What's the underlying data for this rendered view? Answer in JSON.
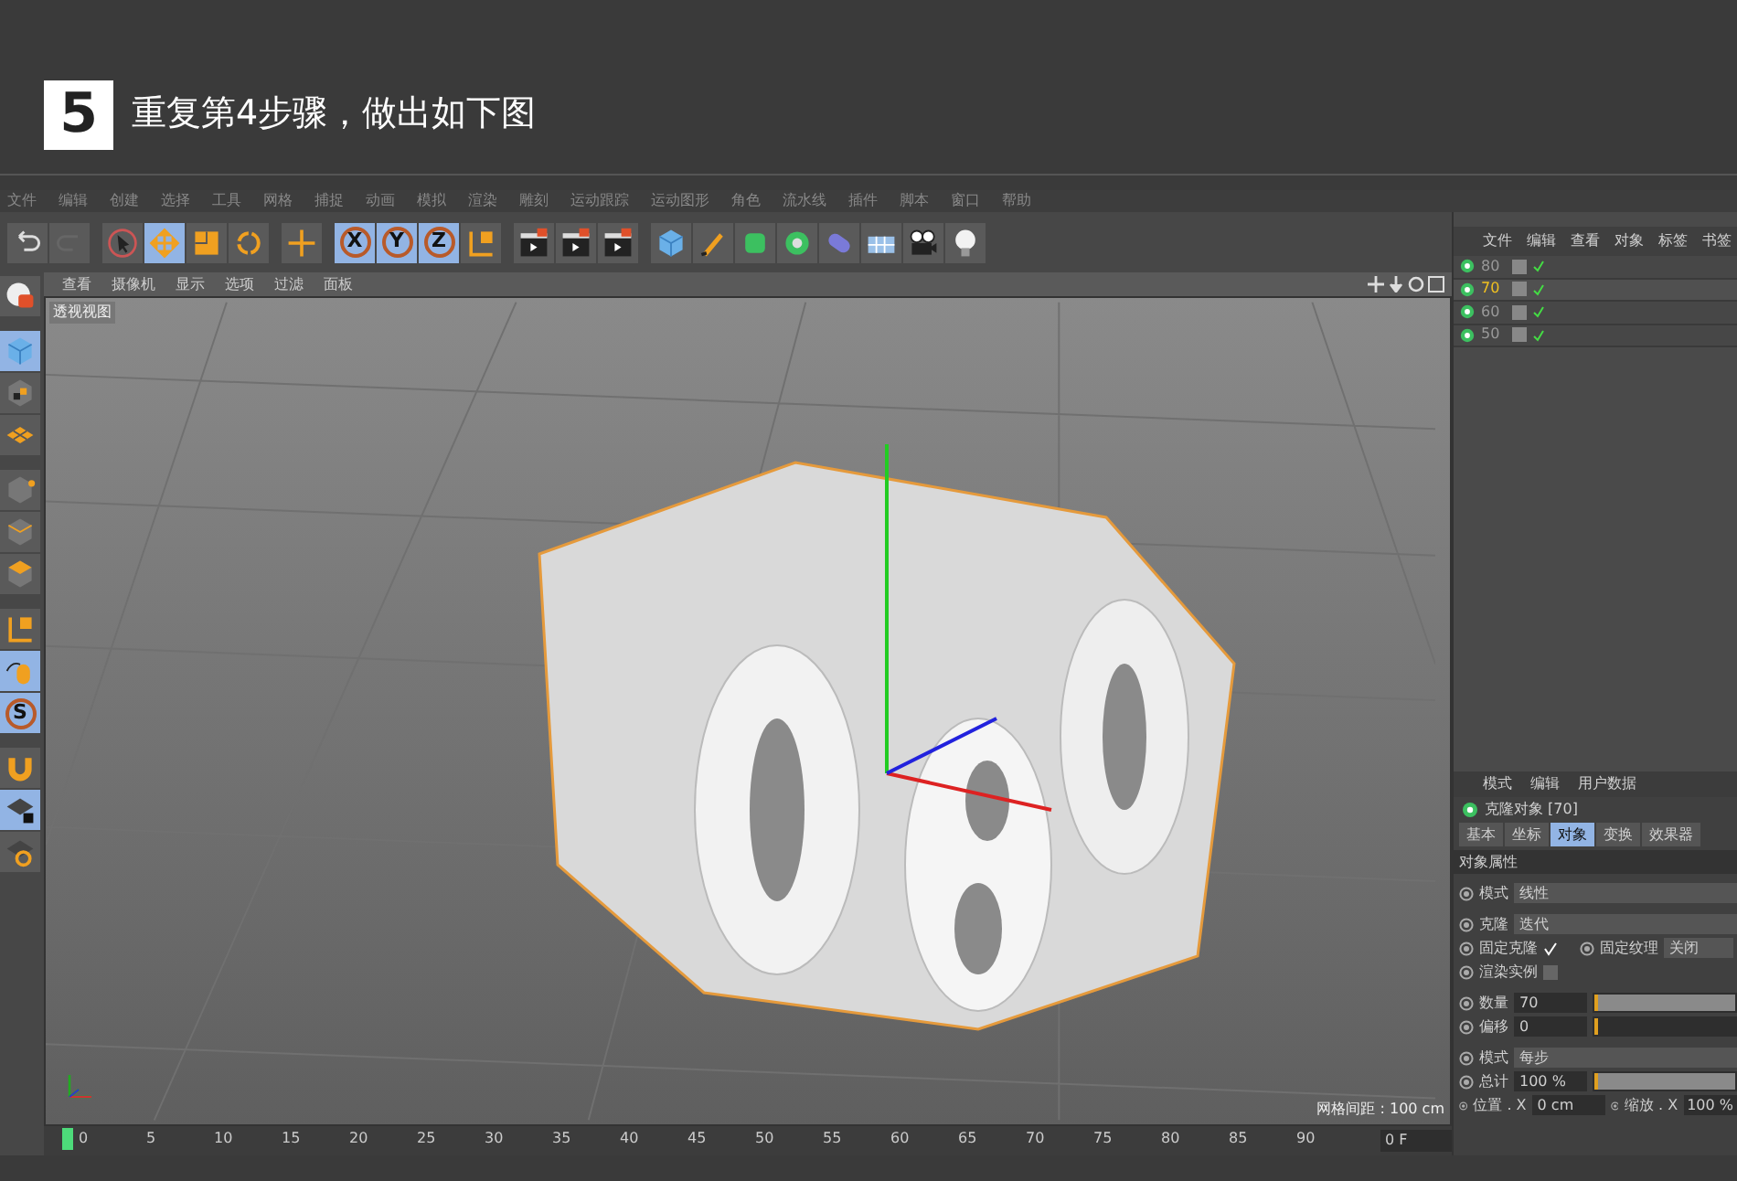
{
  "banner": {
    "step": "5",
    "title": "重复第4步骤，做出如下图"
  },
  "menu": [
    "文件",
    "编辑",
    "创建",
    "选择",
    "工具",
    "网格",
    "捕捉",
    "动画",
    "模拟",
    "渲染",
    "雕刻",
    "运动跟踪",
    "运动图形",
    "角色",
    "流水线",
    "插件",
    "脚本",
    "窗口",
    "帮助"
  ],
  "toolbar": [
    [
      {
        "kind": "undo",
        "selected": false
      },
      {
        "kind": "redo",
        "selected": false
      }
    ],
    [
      {
        "kind": "select",
        "selected": false
      },
      {
        "kind": "move",
        "selected": true
      },
      {
        "kind": "scale",
        "selected": false
      },
      {
        "kind": "rotate",
        "selected": false
      }
    ],
    [
      {
        "kind": "cross",
        "selected": false
      }
    ],
    [
      {
        "kind": "letter",
        "label": "X",
        "selected": true
      },
      {
        "kind": "letter",
        "label": "Y",
        "selected": true
      },
      {
        "kind": "letter",
        "label": "Z",
        "selected": true
      },
      {
        "kind": "axis",
        "selected": false
      }
    ],
    [
      {
        "kind": "clapper",
        "selected": false
      },
      {
        "kind": "clapper",
        "selected": false
      },
      {
        "kind": "clapper",
        "selected": false
      }
    ],
    [
      {
        "kind": "cube",
        "selected": false
      },
      {
        "kind": "pen",
        "selected": false
      },
      {
        "kind": "greencube",
        "selected": false
      },
      {
        "kind": "gear",
        "selected": false
      },
      {
        "kind": "capsule",
        "selected": false
      },
      {
        "kind": "floor",
        "selected": false
      },
      {
        "kind": "camera",
        "selected": false
      },
      {
        "kind": "bulb",
        "selected": false
      }
    ]
  ],
  "left_toolbar": [
    {
      "kind": "sphere",
      "selected": false
    },
    {
      "kind": "cube",
      "selected": true
    },
    {
      "kind": "checker",
      "selected": false
    },
    {
      "kind": "grid",
      "selected": false
    },
    {
      "kind": "points",
      "selected": false
    },
    {
      "kind": "edges",
      "selected": false
    },
    {
      "kind": "polys",
      "selected": false
    },
    {
      "kind": "axis",
      "selected": false
    },
    {
      "kind": "mouse",
      "selected": true
    },
    {
      "kind": "letter",
      "label": "S",
      "selected": true
    },
    {
      "kind": "magnet",
      "selected": false
    },
    {
      "kind": "gridlock",
      "selected": true
    },
    {
      "kind": "gridsync",
      "selected": false
    }
  ],
  "viewport": {
    "menu": [
      "查看",
      "摄像机",
      "显示",
      "选项",
      "过滤",
      "面板"
    ],
    "label": "透视视图",
    "grid_spacing": "网格间距 : 100 cm"
  },
  "object_manager": {
    "menu": [
      "文件",
      "编辑",
      "查看",
      "对象",
      "标签",
      "书签"
    ],
    "objects": [
      {
        "name": "80",
        "selected": false
      },
      {
        "name": "70",
        "selected": true
      },
      {
        "name": "60",
        "selected": false
      },
      {
        "name": "50",
        "selected": false
      }
    ]
  },
  "attributes": {
    "menu": [
      "模式",
      "编辑",
      "用户数据"
    ],
    "object_title": "克隆对象 [70]",
    "tabs": [
      {
        "label": "基本",
        "selected": false
      },
      {
        "label": "坐标",
        "selected": false
      },
      {
        "label": "对象",
        "selected": true
      },
      {
        "label": "变换",
        "selected": false
      },
      {
        "label": "效果器",
        "selected": false
      }
    ],
    "section": "对象属性",
    "mode": {
      "label": "模式",
      "value": "线性"
    },
    "clones": {
      "label": "克隆",
      "value": "迭代"
    },
    "fix_clone": {
      "label": "固定克隆",
      "checked": true
    },
    "fix_texture": {
      "label": "固定纹理",
      "value": "关闭"
    },
    "render_instances": {
      "label": "渲染实例",
      "checked": false
    },
    "count": {
      "label": "数量",
      "value": "70",
      "level": 1
    },
    "offset": {
      "label": "偏移",
      "value": "0",
      "level": 0
    },
    "step_mode": {
      "label": "模式",
      "value": "每步"
    },
    "total": {
      "label": "总计",
      "value": "100 %",
      "level": 1
    },
    "position": {
      "label": "位置 . X",
      "value": "0 cm"
    },
    "scale": {
      "label": "缩放 . X",
      "value": "100 %"
    }
  },
  "timeline": {
    "ticks": [
      "0",
      "5",
      "10",
      "15",
      "20",
      "25",
      "30",
      "35",
      "40",
      "45",
      "50",
      "55",
      "60",
      "65",
      "70",
      "75",
      "80",
      "85",
      "90"
    ],
    "frame": "0 F"
  }
}
